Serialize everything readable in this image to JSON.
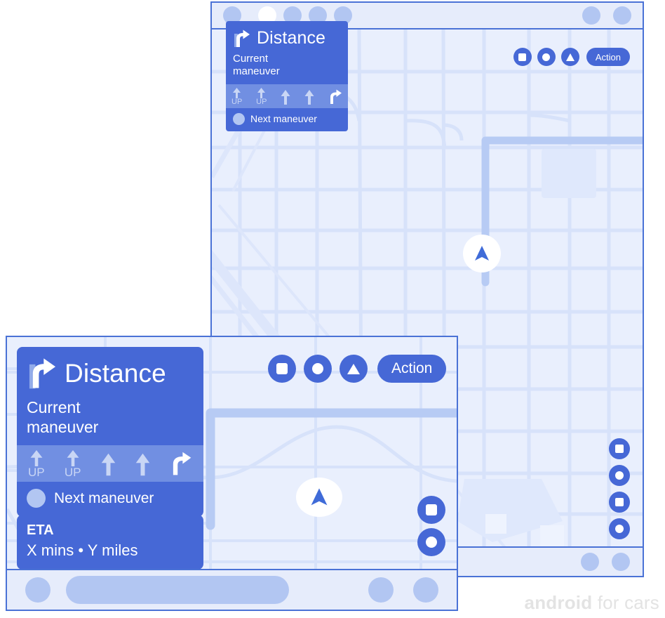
{
  "branding": {
    "strong": "android",
    "light": " for cars"
  },
  "colors": {
    "card_blue": "#4668d6",
    "lane_strip_blue": "#718fe2",
    "map_background": "#e9effd",
    "map_road": "#ccd9f7",
    "map_route": "#a8c0f0",
    "window_border": "#4a72d6",
    "status_bar": "#e6ecfb",
    "dot_blue": "#b2c6f2",
    "dot_active": "#ffffff",
    "branding_grey": "#e3e3e3"
  },
  "background_window": {
    "name": "wide-screen-car-display",
    "status_bar_top": {
      "left_dots": [
        {
          "name": "status-dot-1",
          "active": false
        },
        {
          "name": "status-dot-2",
          "active": true
        },
        {
          "name": "status-dot-3",
          "active": false
        },
        {
          "name": "status-dot-4",
          "active": false
        },
        {
          "name": "status-dot-5",
          "active": false
        }
      ],
      "right_dots": [
        {
          "name": "status-dot-6",
          "active": false
        },
        {
          "name": "status-dot-7",
          "active": false
        }
      ]
    },
    "status_bar_bottom": {
      "right_dots": [
        {
          "name": "nav-dot-1",
          "active": false
        },
        {
          "name": "nav-dot-2",
          "active": false
        }
      ]
    },
    "nav_card": {
      "turn_icon": "turn-right-arrow-icon",
      "title": "Distance",
      "subtitle": "Current\nmaneuver",
      "subtitle_line1": "Current",
      "subtitle_line2": "maneuver",
      "lanes": [
        {
          "icon": "lane-arrow-up-dim-icon",
          "label": "UP",
          "state": "dim"
        },
        {
          "icon": "lane-arrow-up-dim-icon",
          "label": "UP",
          "state": "dim"
        },
        {
          "icon": "lane-arrow-up-icon",
          "label": "",
          "state": "normal"
        },
        {
          "icon": "lane-arrow-up-icon",
          "label": "",
          "state": "normal"
        },
        {
          "icon": "lane-turn-right-icon",
          "label": "",
          "state": "active"
        }
      ],
      "next_maneuver_label": "Next maneuver"
    },
    "actions": [
      {
        "name": "action-button-square",
        "glyph": "square-icon"
      },
      {
        "name": "action-button-circle",
        "glyph": "circle-icon"
      },
      {
        "name": "action-button-triangle",
        "glyph": "triangle-icon"
      },
      {
        "name": "action-button-primary",
        "glyph": "",
        "label": "Action"
      }
    ],
    "map_controls": [
      {
        "name": "map-control-square-1",
        "glyph": "square-icon"
      },
      {
        "name": "map-control-circle-1",
        "glyph": "circle-icon"
      },
      {
        "name": "map-control-square-2",
        "glyph": "square-icon"
      },
      {
        "name": "map-control-circle-2",
        "glyph": "circle-icon"
      }
    ],
    "puck": {
      "name": "location-puck",
      "icon": "navigation-arrow-icon"
    }
  },
  "foreground_window": {
    "name": "compact-screen-car-display",
    "nav_card": {
      "turn_icon": "turn-right-arrow-icon",
      "title": "Distance",
      "subtitle_line1": "Current",
      "subtitle_line2": "maneuver",
      "lanes": [
        {
          "icon": "lane-arrow-up-dim-icon",
          "label": "UP",
          "state": "dim"
        },
        {
          "icon": "lane-arrow-up-dim-icon",
          "label": "UP",
          "state": "dim"
        },
        {
          "icon": "lane-arrow-up-icon",
          "label": "",
          "state": "normal"
        },
        {
          "icon": "lane-arrow-up-icon",
          "label": "",
          "state": "normal"
        },
        {
          "icon": "lane-turn-right-icon",
          "label": "",
          "state": "active"
        }
      ],
      "next_maneuver_label": "Next maneuver"
    },
    "eta_card": {
      "title": "ETA",
      "detail": "X mins • Y miles"
    },
    "actions": [
      {
        "name": "action-button-square",
        "glyph": "square-icon"
      },
      {
        "name": "action-button-circle",
        "glyph": "circle-icon"
      },
      {
        "name": "action-button-triangle",
        "glyph": "triangle-icon"
      },
      {
        "name": "action-button-primary",
        "glyph": "",
        "label": "Action"
      }
    ],
    "map_controls": [
      {
        "name": "map-control-square-1",
        "glyph": "square-icon"
      },
      {
        "name": "map-control-circle-1",
        "glyph": "circle-icon"
      }
    ],
    "puck": {
      "name": "location-puck",
      "icon": "navigation-arrow-icon"
    },
    "bottom_bar": {
      "home_dot": {
        "name": "home-dot"
      },
      "search_pill": {
        "name": "search-pill"
      },
      "right_dots": [
        {
          "name": "bottom-dot-1"
        },
        {
          "name": "bottom-dot-2"
        }
      ]
    }
  }
}
